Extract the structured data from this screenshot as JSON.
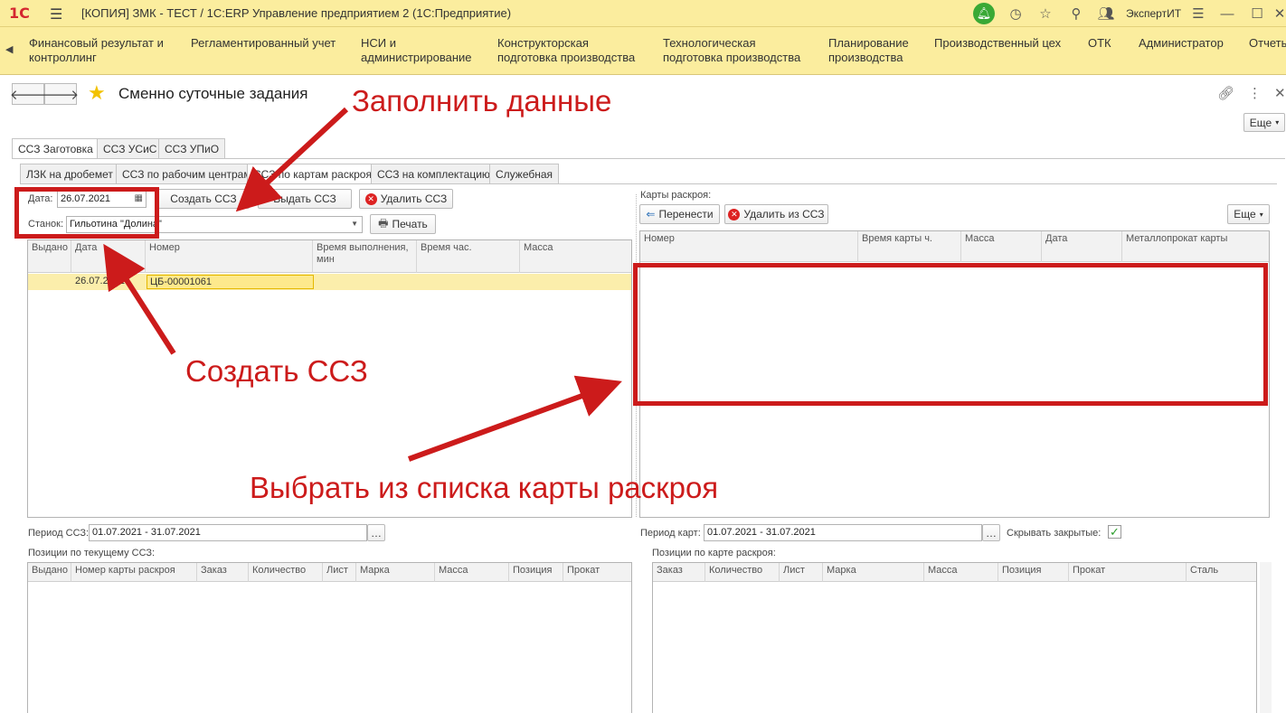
{
  "window": {
    "logo": "1С",
    "title": "[КОПИЯ] ЗМК - ТЕСТ / 1С:ERP Управление предприятием 2  (1С:Предприятие)",
    "user": "ЭкспертИТ"
  },
  "sections": [
    {
      "line1": "Финансовый результат и",
      "line2": "контроллинг"
    },
    {
      "line1": "Регламентированный учет",
      "line2": ""
    },
    {
      "line1": "НСИ и",
      "line2": "администрирование"
    },
    {
      "line1": "Конструкторская",
      "line2": "подготовка производства"
    },
    {
      "line1": "Технологическая",
      "line2": "подготовка производства"
    },
    {
      "line1": "Планирование",
      "line2": "производства"
    },
    {
      "line1": "Производственный цех",
      "line2": ""
    },
    {
      "line1": "ОТК",
      "line2": ""
    },
    {
      "line1": "Администратор",
      "line2": ""
    },
    {
      "line1": "Отчеты",
      "line2": ""
    }
  ],
  "header": {
    "title": "Сменно суточные задания",
    "more": "Еще"
  },
  "tabs_top": [
    "ССЗ Заготовка",
    "ССЗ УСиС",
    "ССЗ УПиО"
  ],
  "tabs_sub": [
    "ЛЗК на дробемет",
    "ССЗ по рабочим центрам",
    "ССЗ по картам раскроя",
    "ССЗ на комплектацию",
    "Служебная"
  ],
  "left": {
    "date_label": "Дата:",
    "date_value": "26.07.2021",
    "create_btn": "Создать ССЗ",
    "issue_btn": "Выдать ССЗ",
    "delete_btn": "Удалить ССЗ",
    "machine_label": "Станок:",
    "machine_value": "Гильотина \"Долина\"",
    "print_btn": "Печать",
    "columns": [
      "Выдано",
      "Дата",
      "Номер",
      "Время выполнения, мин",
      "Время час.",
      "Масса"
    ],
    "rows": [
      {
        "issued": "",
        "date": "26.07.2021",
        "number": "ЦБ-00001061",
        "time_min": "",
        "time_h": "",
        "mass": ""
      }
    ],
    "period_label": "Период ССЗ:",
    "period_value": "01.07.2021 - 31.07.2021",
    "positions_label": "Позиции по текущему ССЗ:",
    "pos_columns": [
      "Выдано",
      "Номер карты раскроя",
      "Заказ",
      "Количество",
      "Лист",
      "Марка",
      "Масса",
      "Позиция",
      "Прокат"
    ]
  },
  "right": {
    "maps_label": "Карты раскроя:",
    "move_btn": "Перенести",
    "remove_btn": "Удалить из ССЗ",
    "more": "Еще",
    "columns": [
      "Номер",
      "Время карты ч.",
      "Масса",
      "Дата",
      "Металлопрокат карты"
    ],
    "period_label": "Период карт:",
    "period_value": "01.07.2021 - 31.07.2021",
    "hide_closed_label": "Скрывать закрытые:",
    "hide_closed": true,
    "positions_label": "Позиции по карте раскроя:",
    "pos_columns": [
      "Заказ",
      "Количество",
      "Лист",
      "Марка",
      "Масса",
      "Позиция",
      "Прокат",
      "Сталь"
    ]
  },
  "annotations": {
    "fill_data": "Заполнить данные",
    "create": "Создать ССЗ",
    "select": "Выбрать из списка карты раскроя",
    "color": "#cc1b1b"
  }
}
